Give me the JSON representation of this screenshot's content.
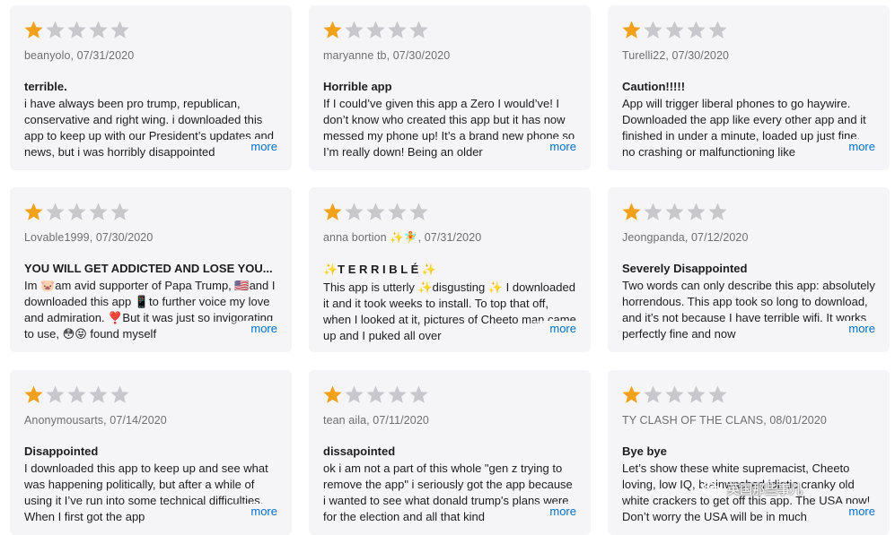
{
  "colors": {
    "star_filled": "#f3a01a",
    "star_empty": "#c7c7cc",
    "link": "#0070c9",
    "card_bg": "#f5f5f7"
  },
  "more_label": "more",
  "reviews": [
    {
      "rating": 1,
      "author_date": "beanyolo, 07/31/2020",
      "title": "terrible.",
      "body": "i have always been pro trump, republican, conservative and right wing. i downloaded this app to keep up with our President’s updates and news, but i was horribly disappointed"
    },
    {
      "rating": 1,
      "author_date": "maryanne tb, 07/30/2020",
      "title": "Horrible app",
      "body": "If I could’ve given this app a Zero I would’ve! I don’t know who created this app but it has now messed my phone up! It’s a brand new phone so I’m really down! Being an older"
    },
    {
      "rating": 1,
      "author_date": "Turelli22, 07/30/2020",
      "title": "Caution!!!!!",
      "body": "App will trigger liberal phones to go haywire. Downloaded the app like every other app and it finished in under a minute, loaded up just fine, no crashing or malfunctioning like"
    },
    {
      "rating": 1,
      "author_date": "Lovable1999, 07/30/2020",
      "title": "YOU WILL GET ADDICTED AND LOSE YOU...",
      "body": "Im 🐷am avid supporter of Papa Trump, 🇺🇸and I downloaded this app 📱to further voice my love and admiration. ❣️But it was just so invigorating to use, 😳😝 found myself"
    },
    {
      "rating": 1,
      "author_date": "anna bortion ✨🧚, 07/31/2020",
      "title": "✨T E R R I B L É ✨",
      "body": "This app is utterly ✨disgusting ✨ I downloaded it and it took weeks to install. To top that off, when I looked at it, pictures of Cheeto man came up and I puked all over"
    },
    {
      "rating": 1,
      "author_date": "Jeongpanda, 07/12/2020",
      "title": "Severely Disappointed",
      "body": "Two words can only describe this app: absolutely horrendous. This app took so long to download, and it’s not because I have terrible wifi. It works perfectly fine and now"
    },
    {
      "rating": 1,
      "author_date": "Anonymousarts, 07/14/2020",
      "title": "Disappointed",
      "body": "I downloaded this app to keep up and see what was happening politically, but after a while of using it I’ve run into some technical difficulties. When I first got the app"
    },
    {
      "rating": 1,
      "author_date": "tean aila, 07/11/2020",
      "title": "dissapointed",
      "body": "ok i am not a part of this whole \"gen z trying to remove the app\" i seriously got the app because i wanted to see what donald trump's plans were for the election and all that kind"
    },
    {
      "rating": 1,
      "author_date": "TY CLASH OF THE CLANS, 08/01/2020",
      "title": "Bye bye",
      "body": "Let’s show these white supremacist, Cheeto loving, low IQ, brainwashed idiotic cranky old white crackers to get off this app. The USA now! Don’t worry the USA will be in much"
    }
  ],
  "watermark": {
    "text": "英国那些事儿",
    "icon": "wechat-logo-icon"
  }
}
